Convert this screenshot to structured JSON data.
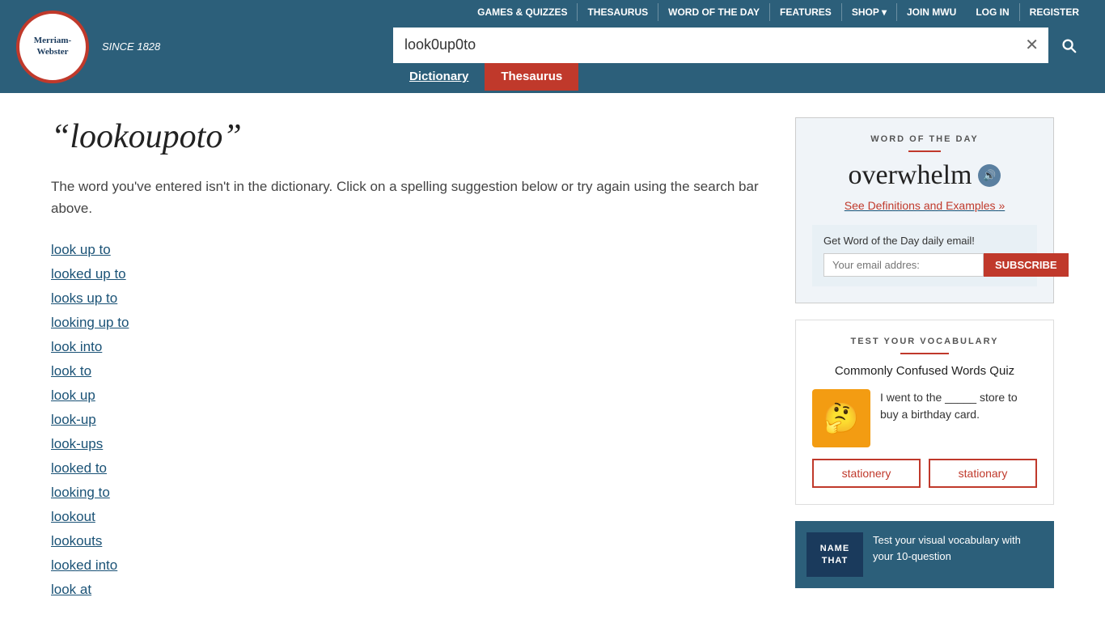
{
  "header": {
    "logo": {
      "name": "Merriam-\nWebster",
      "since": "SINCE 1828"
    },
    "nav": {
      "items": [
        {
          "label": "GAMES & QUIZZES",
          "id": "games"
        },
        {
          "label": "THESAURUS",
          "id": "thesaurus"
        },
        {
          "label": "WORD OF THE DAY",
          "id": "wotd"
        },
        {
          "label": "FEATURES",
          "id": "features"
        },
        {
          "label": "SHOP ▾",
          "id": "shop"
        },
        {
          "label": "JOIN MWU",
          "id": "join"
        }
      ],
      "auth": [
        {
          "label": "LOG IN",
          "id": "login"
        },
        {
          "label": "REGISTER",
          "id": "register"
        }
      ]
    },
    "search": {
      "value": "look0up0to",
      "clear_label": "✕",
      "tabs": {
        "dictionary": "Dictionary",
        "thesaurus": "Thesaurus"
      }
    }
  },
  "main": {
    "title": "“lookoupoto”",
    "not_found_text": "The word you've entered isn't in the dictionary. Click on a spelling suggestion below or try again using the search bar above.",
    "suggestions": [
      "look up to",
      "looked up to",
      "looks up to",
      "looking up to",
      "look into",
      "look to",
      "look up",
      "look-up",
      "look-ups",
      "looked to",
      "looking to",
      "lookout",
      "lookouts",
      "looked into",
      "look at"
    ]
  },
  "sidebar": {
    "wotd": {
      "section_label": "WORD OF THE DAY",
      "word": "overwhelm",
      "audio_icon": "🔊",
      "link_text": "See Definitions and Examples",
      "link_arrow": "»",
      "email_section": {
        "label": "Get Word of the Day daily email!",
        "placeholder": "Your email addres:",
        "subscribe_label": "SUBSCRIBE"
      }
    },
    "vocab": {
      "section_label": "TEST YOUR VOCABULARY",
      "quiz_title": "Commonly Confused Words Quiz",
      "question_text": "I went to the _____ store to buy a birthday card.",
      "emoji": "🤔",
      "options": [
        "stationery",
        "stationary"
      ]
    },
    "ntt": {
      "image_label": "NAME\nTHAT",
      "text": "Test your visual vocabulary with your 10-question"
    }
  }
}
